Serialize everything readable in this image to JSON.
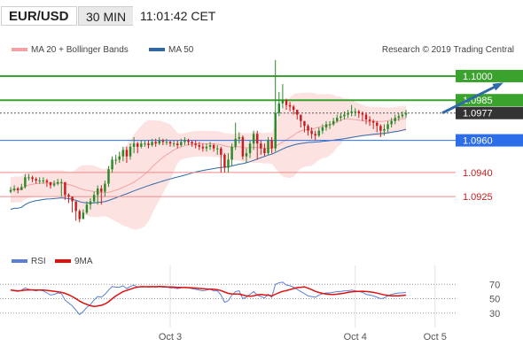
{
  "header": {
    "symbol": "EUR/USD",
    "timeframe": "30 MIN",
    "time": "11:01:42 CET"
  },
  "legend": {
    "ma_bollinger": "MA 20 + Bollinger Bands",
    "ma50": "MA 50",
    "credit": "Research © 2019 Trading Central"
  },
  "rsi_legend": {
    "rsi": "RSI",
    "ma": "9MA"
  },
  "colors": {
    "up": "#2a8a2a",
    "down": "#c81d1d",
    "ma20": "#f3a3a3",
    "band_fill": "#fde2e2",
    "ma50": "#2f6aa6",
    "green_level": "#3aa32d",
    "blue_level": "#2d6ee8",
    "red_level": "#f08a8a",
    "arrow": "#2f6aa6",
    "rsi": "#5b7fd6",
    "rsi_ma": "#e01010"
  },
  "chart_data": {
    "type": "candlestick",
    "title": "EUR/USD 30 MIN",
    "y_range": [
      1.0892,
      1.1011
    ],
    "levels": [
      {
        "value": 1.1,
        "label": "1.1000",
        "style": "green"
      },
      {
        "value": 1.0985,
        "label": "1.0985",
        "style": "green"
      },
      {
        "value": 1.0977,
        "label": "1.0977",
        "style": "current"
      },
      {
        "value": 1.096,
        "label": "1.0960",
        "style": "blue"
      },
      {
        "value": 1.094,
        "label": "1.0940",
        "style": "red"
      },
      {
        "value": 1.0925,
        "label": "1.0925",
        "style": "red"
      }
    ],
    "x_ticks": [
      "Oct 3",
      "Oct 4",
      "Oct 5"
    ],
    "x_tick_index": [
      44,
      95,
      117
    ],
    "projection": {
      "from_index": 119,
      "from_price": 1.0977,
      "to_index": 135,
      "to_price": 1.0995
    },
    "close": [
      1.0929,
      1.093,
      1.0929,
      1.0931,
      1.0937,
      1.0937,
      1.0936,
      1.0935,
      1.0935,
      1.0935,
      1.0934,
      1.0932,
      1.0933,
      1.0934,
      1.0934,
      1.0926,
      1.0925,
      1.0922,
      1.0916,
      1.0911,
      1.0915,
      1.092,
      1.0922,
      1.0926,
      1.093,
      1.0928,
      1.0933,
      1.0942,
      1.0948,
      1.0948,
      1.095,
      1.0954,
      1.095,
      1.0956,
      1.0958,
      1.0956,
      1.0958,
      1.0958,
      1.0957,
      1.0959,
      1.0958,
      1.096,
      1.0959,
      1.0959,
      1.0958,
      1.0958,
      1.0957,
      1.0959,
      1.096,
      1.0959,
      1.0958,
      1.0957,
      1.0956,
      1.0955,
      1.0956,
      1.0957,
      1.0955,
      1.0955,
      1.0951,
      1.0943,
      1.0948,
      1.0956,
      1.0961,
      1.0962,
      1.095,
      1.0952,
      1.0958,
      1.0964,
      1.0958,
      1.0955,
      1.0952,
      1.096,
      1.0955,
      1.0977,
      1.0983,
      1.0985,
      1.0982,
      1.0981,
      1.0979,
      1.0976,
      1.0972,
      1.0969,
      1.0966,
      1.0964,
      1.0963,
      1.0966,
      1.0968,
      1.097,
      1.097,
      1.0972,
      1.0974,
      1.0975,
      1.0976,
      1.0977,
      1.0978,
      1.0978,
      1.0977,
      1.0976,
      1.0973,
      1.0972,
      1.0971,
      1.0969,
      1.0966,
      1.0967,
      1.097,
      1.0972,
      1.0974,
      1.0975,
      1.0976,
      1.0977
    ],
    "high": [
      1.0931,
      1.0932,
      1.0931,
      1.0933,
      1.0939,
      1.0939,
      1.0938,
      1.0937,
      1.0937,
      1.0937,
      1.0936,
      1.0934,
      1.0935,
      1.0936,
      1.0936,
      1.0934,
      1.0927,
      1.0924,
      1.0922,
      1.0917,
      1.0917,
      1.0922,
      1.0924,
      1.0928,
      1.0932,
      1.0932,
      1.0935,
      1.0944,
      1.095,
      1.0951,
      1.0953,
      1.0956,
      1.0956,
      1.0958,
      1.0962,
      1.0959,
      1.096,
      1.096,
      1.096,
      1.0961,
      1.0961,
      1.0962,
      1.0961,
      1.0961,
      1.096,
      1.096,
      1.096,
      1.0961,
      1.0962,
      1.0961,
      1.096,
      1.096,
      1.0959,
      1.0958,
      1.0958,
      1.0959,
      1.0958,
      1.0957,
      1.0956,
      1.0952,
      1.0952,
      1.0958,
      1.0971,
      1.0965,
      1.0963,
      1.0955,
      1.096,
      1.0966,
      1.0966,
      1.096,
      1.0958,
      1.0962,
      1.0962,
      1.101,
      1.099,
      1.0995,
      1.0986,
      1.0984,
      1.0982,
      1.0979,
      1.0976,
      1.0972,
      1.097,
      1.0968,
      1.0966,
      1.0968,
      1.097,
      1.0972,
      1.0972,
      1.0974,
      1.0976,
      1.0977,
      1.0978,
      1.0979,
      1.0982,
      1.098,
      1.0979,
      1.0978,
      1.0977,
      1.0975,
      1.0973,
      1.0972,
      1.097,
      1.097,
      1.0972,
      1.0974,
      1.0976,
      1.0977,
      1.0978,
      1.0979
    ],
    "low": [
      1.0927,
      1.0928,
      1.0927,
      1.0929,
      1.093,
      1.0935,
      1.0934,
      1.0933,
      1.0933,
      1.0933,
      1.0931,
      1.093,
      1.0931,
      1.0932,
      1.0925,
      1.0923,
      1.0921,
      1.0915,
      1.091,
      1.0909,
      1.0911,
      1.0914,
      1.0917,
      1.0921,
      1.092,
      1.092,
      1.0925,
      1.0931,
      1.094,
      1.0945,
      1.0946,
      1.0947,
      1.0946,
      1.0948,
      1.0952,
      1.0952,
      1.0955,
      1.0956,
      1.0955,
      1.0956,
      1.0956,
      1.0957,
      1.0957,
      1.0957,
      1.0956,
      1.0956,
      1.0955,
      1.0956,
      1.0957,
      1.0957,
      1.0956,
      1.0955,
      1.0954,
      1.0953,
      1.0953,
      1.0954,
      1.0953,
      1.0951,
      1.094,
      1.094,
      1.094,
      1.0944,
      1.0954,
      1.0958,
      1.0948,
      1.0946,
      1.0949,
      1.0954,
      1.0948,
      1.0951,
      1.095,
      1.0951,
      1.0952,
      1.0953,
      1.0975,
      1.098,
      1.0979,
      1.0978,
      1.0976,
      1.0973,
      1.0968,
      1.0965,
      1.0963,
      1.0961,
      1.096,
      1.0962,
      1.0964,
      1.0966,
      1.0967,
      1.0969,
      1.0971,
      1.0972,
      1.0973,
      1.0974,
      1.0975,
      1.0975,
      1.0974,
      1.0972,
      1.097,
      1.0969,
      1.0967,
      1.0965,
      1.0962,
      1.0963,
      1.0965,
      1.0968,
      1.097,
      1.0972,
      1.0974,
      1.0974
    ],
    "rsi": [
      62,
      61,
      60,
      62,
      65,
      63,
      62,
      61,
      62,
      61,
      58,
      55,
      56,
      58,
      57,
      48,
      44,
      40,
      34,
      28,
      32,
      38,
      42,
      48,
      53,
      52,
      56,
      62,
      67,
      66,
      66,
      68,
      64,
      67,
      69,
      66,
      67,
      67,
      66,
      67,
      66,
      67,
      66,
      66,
      65,
      65,
      64,
      65,
      66,
      65,
      64,
      63,
      62,
      61,
      62,
      63,
      61,
      61,
      55,
      45,
      47,
      55,
      60,
      61,
      50,
      52,
      56,
      60,
      55,
      53,
      51,
      56,
      52,
      70,
      72,
      73,
      69,
      68,
      66,
      63,
      60,
      57,
      54,
      53,
      52,
      55,
      57,
      58,
      58,
      59,
      60,
      60,
      61,
      61,
      62,
      61,
      60,
      59,
      56,
      55,
      54,
      52,
      50,
      51,
      54,
      56,
      57,
      58,
      58,
      59
    ],
    "rsi_ticks": [
      30,
      50,
      70
    ]
  }
}
